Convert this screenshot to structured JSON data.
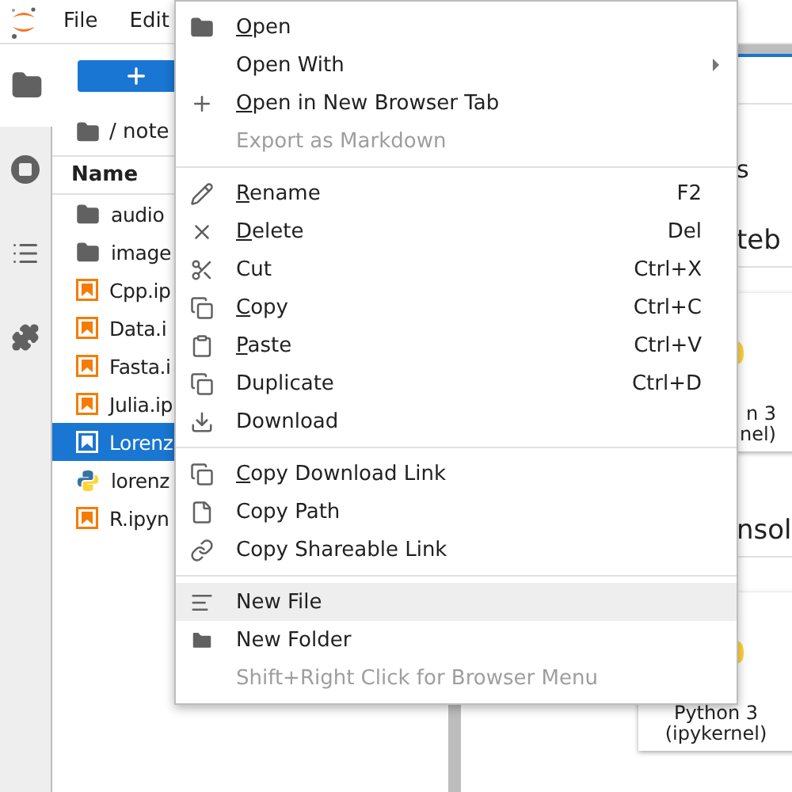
{
  "menubar": {
    "items": [
      "File",
      "Edit"
    ]
  },
  "sidebar_tabs": [
    {
      "selected": true
    },
    {
      "selected": false
    },
    {
      "selected": false
    },
    {
      "selected": false
    }
  ],
  "file_browser": {
    "breadcrumb": "/ note",
    "column": "Name",
    "files": [
      {
        "name": "audio",
        "kind": "folder",
        "selected": false
      },
      {
        "name": "image",
        "kind": "folder",
        "selected": false
      },
      {
        "name": "Cpp.ip",
        "kind": "notebook",
        "selected": false
      },
      {
        "name": "Data.i",
        "kind": "notebook",
        "selected": false
      },
      {
        "name": "Fasta.i",
        "kind": "notebook",
        "selected": false
      },
      {
        "name": "Julia.ip",
        "kind": "notebook",
        "selected": false
      },
      {
        "name": "Lorenz",
        "kind": "notebook",
        "selected": true
      },
      {
        "name": "lorenz",
        "kind": "python",
        "selected": false
      },
      {
        "name": "R.ipyn",
        "kind": "notebook",
        "selected": false
      }
    ]
  },
  "launcher": {
    "sections": [
      {
        "headings": [
          "s",
          "teb"
        ],
        "card_lines": [
          "n 3",
          "nel)"
        ]
      },
      {
        "headings": [
          "nsol"
        ],
        "card_lines": [
          "Python 3",
          "(ipykernel)"
        ]
      }
    ]
  },
  "context_menu": {
    "groups": [
      {
        "items": [
          {
            "label": "Open",
            "underline": true,
            "disabled": false,
            "selected": false,
            "submenu": false
          },
          {
            "label": "Open With",
            "underline": false,
            "disabled": false,
            "selected": false,
            "submenu": true
          },
          {
            "label": "Open in New Browser Tab",
            "underline": true,
            "disabled": false,
            "selected": false,
            "submenu": false
          },
          {
            "label": "Export as Markdown",
            "underline": false,
            "disabled": true,
            "selected": false,
            "submenu": false
          }
        ]
      },
      {
        "items": [
          {
            "label": "Rename",
            "shortcut": "F2",
            "underline": true,
            "disabled": false,
            "selected": false,
            "submenu": false
          },
          {
            "label": "Delete",
            "shortcut": "Del",
            "underline": true,
            "disabled": false,
            "selected": false,
            "submenu": false
          },
          {
            "label": "Cut",
            "shortcut": "Ctrl+X",
            "underline": false,
            "disabled": false,
            "selected": false,
            "submenu": false
          },
          {
            "label": "Copy",
            "shortcut": "Ctrl+C",
            "underline": true,
            "disabled": false,
            "selected": false,
            "submenu": false
          },
          {
            "label": "Paste",
            "shortcut": "Ctrl+V",
            "underline": true,
            "disabled": false,
            "selected": false,
            "submenu": false
          },
          {
            "label": "Duplicate",
            "shortcut": "Ctrl+D",
            "underline": false,
            "disabled": false,
            "selected": false,
            "submenu": false
          },
          {
            "label": "Download",
            "underline": false,
            "disabled": false,
            "selected": false,
            "submenu": false
          }
        ]
      },
      {
        "items": [
          {
            "label": "Copy Download Link",
            "underline": true,
            "disabled": false,
            "selected": false,
            "submenu": false
          },
          {
            "label": "Copy Path",
            "underline": false,
            "disabled": false,
            "selected": false,
            "submenu": false
          },
          {
            "label": "Copy Shareable Link",
            "underline": false,
            "disabled": false,
            "selected": false,
            "submenu": false
          }
        ]
      },
      {
        "items": [
          {
            "label": "New File",
            "underline": false,
            "disabled": false,
            "selected": true,
            "submenu": false
          },
          {
            "label": "New Folder",
            "underline": false,
            "disabled": false,
            "selected": false,
            "submenu": false
          },
          {
            "label": "Shift+Right Click for Browser Menu",
            "underline": false,
            "disabled": true,
            "selected": false,
            "submenu": false
          }
        ]
      }
    ]
  }
}
